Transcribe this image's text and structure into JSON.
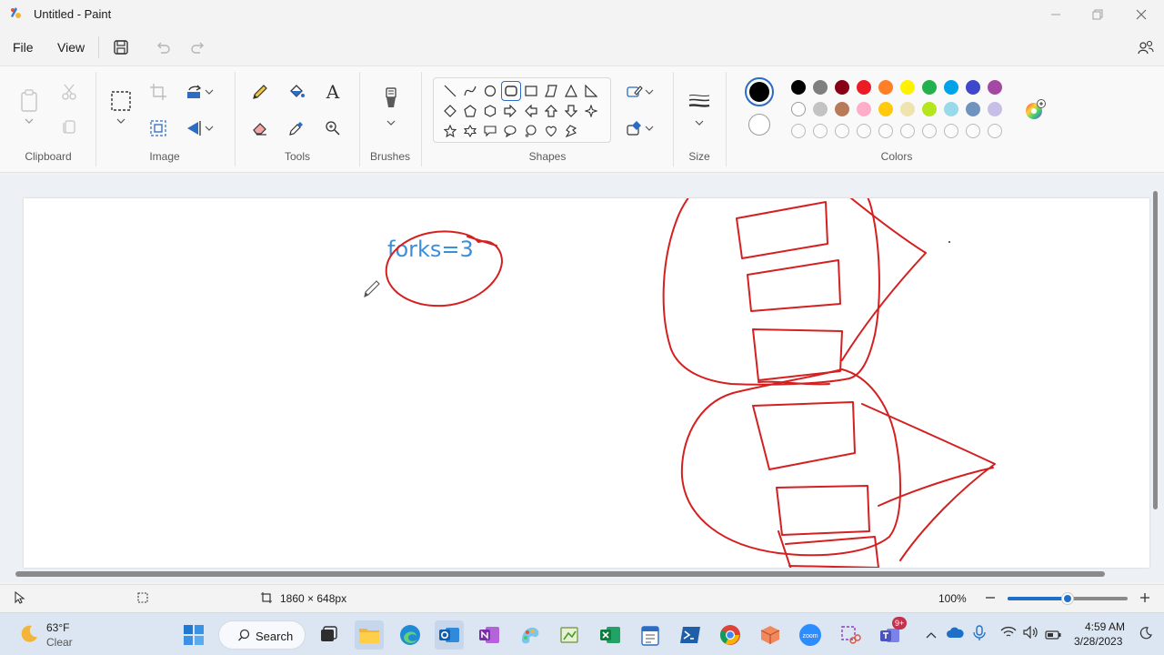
{
  "window": {
    "title": "Untitled - Paint"
  },
  "menu": {
    "file": "File",
    "view": "View"
  },
  "ribbon": {
    "groups": {
      "clipboard": "Clipboard",
      "image": "Image",
      "tools": "Tools",
      "brushes": "Brushes",
      "shapes": "Shapes",
      "size": "Size",
      "colors": "Colors"
    },
    "text_tool_glyph": "A",
    "colors": {
      "primary": "#000000",
      "secondary": "#ffffff",
      "row1": [
        "#000000",
        "#7f7f7f",
        "#880015",
        "#ed1c24",
        "#ff7f27",
        "#fff200",
        "#22b14c",
        "#00a2e8",
        "#3f48cc",
        "#a349a4"
      ],
      "row2": [
        "#ffffff",
        "#c3c3c3",
        "#b97a57",
        "#ffaec9",
        "#ffc90e",
        "#efe4b0",
        "#b5e61d",
        "#99d9ea",
        "#7092be",
        "#c8bfe7"
      ]
    }
  },
  "canvas": {
    "text": "forks=3",
    "text_color": "#3b8fd9",
    "ink_color": "#d42020"
  },
  "status": {
    "dimensions": "1860 × 648px",
    "zoom": "100%",
    "zoom_level": 0.5
  },
  "taskbar": {
    "weather_temp": "63°F",
    "weather_desc": "Clear",
    "search_label": "Search",
    "time": "4:59 AM",
    "date": "3/28/2023",
    "teams_badge": "9+",
    "zoom_app_label": "zoom"
  }
}
